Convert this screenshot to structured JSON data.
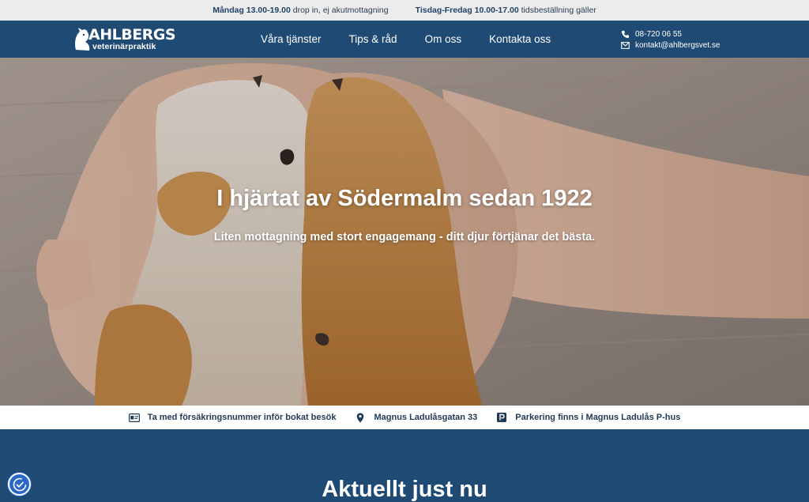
{
  "topbar": {
    "monday_bold": "Måndag 13.00-19.00",
    "monday_text": " drop in, ej akutmottagning",
    "weekday_bold": "Tisdag-Fredag 10.00-17.00",
    "weekday_text": " tidsbeställning gäller"
  },
  "nav": {
    "logo": {
      "brand": "AHLBERGS",
      "sub": "veterinärpraktik"
    },
    "menu": [
      "Våra tjänster",
      "Tips & råd",
      "Om oss",
      "Kontakta oss"
    ],
    "phone": "08-720 06 55",
    "email": "kontakt@ahlbergsvet.se"
  },
  "hero": {
    "title": "I hjärtat av Södermalm sedan 1922",
    "subtitle": "Liten mottagning med stort engagemang - ditt djur förtjänar det bästa."
  },
  "strip": [
    {
      "icon": "id-card-icon",
      "text": "Ta med försäkringsnummer inför bokat besök"
    },
    {
      "icon": "map-pin-icon",
      "text": "Magnus Ladulåsgatan 33"
    },
    {
      "icon": "parking-icon",
      "text": "Parkering finns i Magnus Ladulås P-hus"
    }
  ],
  "section": {
    "title": "Aktuellt just nu"
  },
  "colors": {
    "navy": "#1f4a74",
    "topbar": "#ececec",
    "accessibility": "#2a67c9"
  }
}
